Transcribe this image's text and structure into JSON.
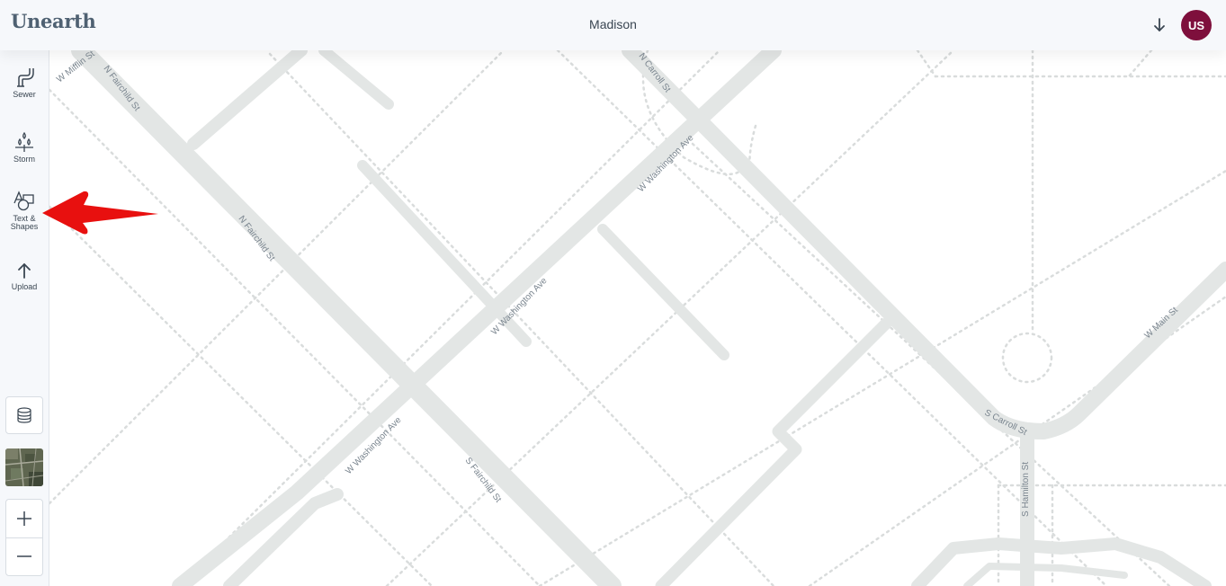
{
  "header": {
    "logo": "Unearth",
    "map_title": "Madison",
    "user_initials": "US"
  },
  "sidebar": {
    "tools": [
      {
        "label": "Sewer"
      },
      {
        "label": "Storm"
      },
      {
        "label": "Text & Shapes"
      },
      {
        "label": "Upload"
      }
    ]
  },
  "map": {
    "street_labels": [
      "W Mifflin St",
      "N Fairchild St",
      "N Carroll St",
      "W Washington Ave",
      "N Fairchild St",
      "W Washington Ave",
      "W Main St",
      "W Washington Ave",
      "S Fairchild St",
      "S Carroll St",
      "S Hamilton St"
    ]
  },
  "colors": {
    "avatar": "#7e0f3c",
    "road": "#e3e6e5",
    "annotation_arrow": "#e8100f"
  }
}
